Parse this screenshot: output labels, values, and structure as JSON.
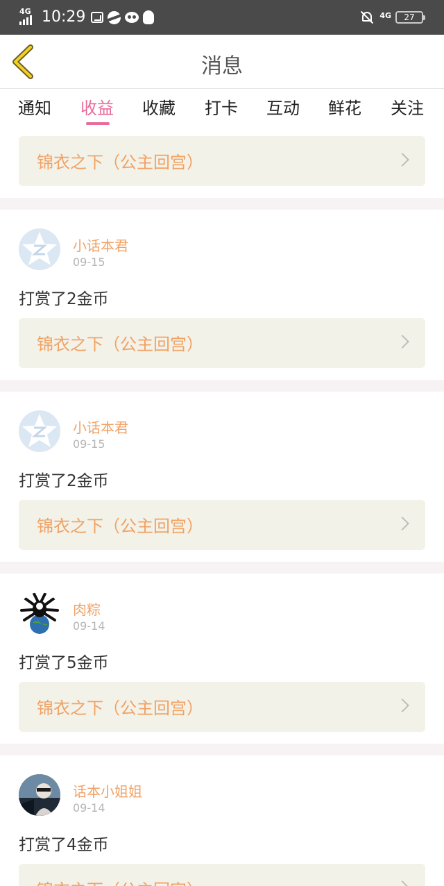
{
  "status_bar": {
    "network": "4G",
    "time": "10:29",
    "network_right": "4G",
    "battery": "27"
  },
  "header": {
    "title": "消息",
    "back_icon": "chevron-left-icon"
  },
  "tabs": [
    {
      "label": "通知",
      "active": false
    },
    {
      "label": "收益",
      "active": true
    },
    {
      "label": "收藏",
      "active": false
    },
    {
      "label": "打卡",
      "active": false
    },
    {
      "label": "互动",
      "active": false
    },
    {
      "label": "鲜花",
      "active": false
    },
    {
      "label": "关注",
      "active": false
    }
  ],
  "colors": {
    "accent": "#e86b9a",
    "name": "#f0a265",
    "card_bg": "#f3f2e8",
    "separator": "#f7f3f4"
  },
  "top_card": {
    "book_title": "锦衣之下（公主回宫）"
  },
  "feed": [
    {
      "user": "小话本君",
      "date": "09-15",
      "action": "打赏了2金币",
      "book_title": "锦衣之下（公主回宫）",
      "avatar": "default-star-avatar"
    },
    {
      "user": "小话本君",
      "date": "09-15",
      "action": "打赏了2金币",
      "book_title": "锦衣之下（公主回宫）",
      "avatar": "default-star-avatar"
    },
    {
      "user": "肉粽",
      "date": "09-14",
      "action": "打赏了5金币",
      "book_title": "锦衣之下（公主回宫）",
      "avatar": "bug-globe-avatar"
    },
    {
      "user": "话本小姐姐",
      "date": "09-14",
      "action": "打赏了4金币",
      "book_title": "锦衣之下（公主回宫）",
      "avatar": "photo-avatar"
    }
  ]
}
